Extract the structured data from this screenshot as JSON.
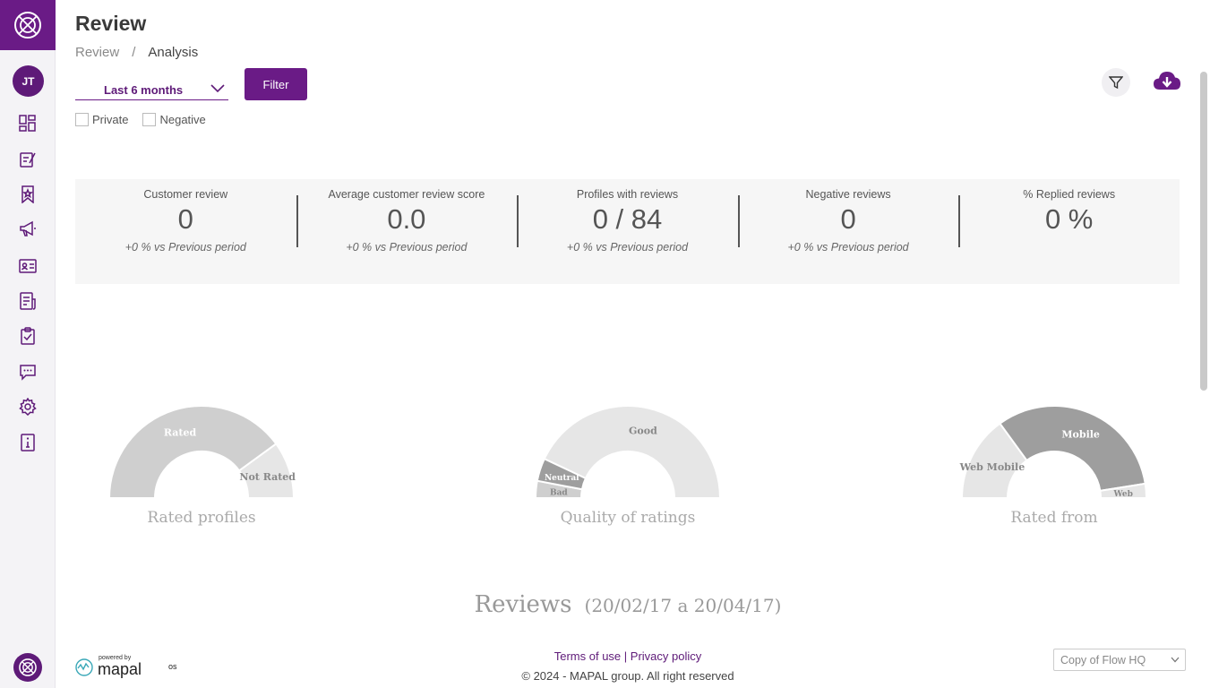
{
  "header": {
    "title": "Review"
  },
  "breadcrumb": {
    "root": "Review",
    "separator": "/",
    "current": "Analysis"
  },
  "filters": {
    "period": "Last 6 months",
    "filter_button": "Filter",
    "private_label": "Private",
    "negative_label": "Negative"
  },
  "sidebar": {
    "avatar_initials": "JT",
    "items": [
      {
        "icon": "dashboard-icon"
      },
      {
        "icon": "edit-icon"
      },
      {
        "icon": "bookmark-star-icon"
      },
      {
        "icon": "megaphone-icon"
      },
      {
        "icon": "id-card-icon"
      },
      {
        "icon": "document-icon"
      },
      {
        "icon": "checklist-icon"
      },
      {
        "icon": "chat-icon"
      },
      {
        "icon": "gear-icon"
      },
      {
        "icon": "info-icon"
      }
    ]
  },
  "kpis": [
    {
      "label": "Customer review",
      "value": "0",
      "delta": "+0 % vs Previous period"
    },
    {
      "label": "Average customer review score",
      "value": "0.0",
      "delta": "+0 % vs Previous period"
    },
    {
      "label": "Profiles with reviews",
      "value": "0 / 84",
      "delta": "+0 % vs Previous period"
    },
    {
      "label": "Negative reviews",
      "value": "0",
      "delta": "+0 % vs Previous period"
    },
    {
      "label": "% Replied reviews",
      "value": "0 %",
      "delta": ""
    }
  ],
  "gauges": [
    {
      "title": "Rated profiles",
      "segments": [
        {
          "label": "Rated",
          "share": 0.8
        },
        {
          "label": "Not Rated",
          "share": 0.2
        }
      ]
    },
    {
      "title": "Quality of ratings",
      "segments": [
        {
          "label": "Bad",
          "share": 0.06
        },
        {
          "label": "Neutral",
          "share": 0.08
        },
        {
          "label": "Good",
          "share": 0.86
        }
      ]
    },
    {
      "title": "Rated from",
      "segments": [
        {
          "label": "Web Mobile",
          "share": 0.3
        },
        {
          "label": "Mobile",
          "share": 0.65
        },
        {
          "label": "Web",
          "share": 0.05
        }
      ]
    }
  ],
  "reviews": {
    "title": "Reviews",
    "range": "(20/02/17 a 20/04/17)"
  },
  "footer": {
    "powered_by": "powered by",
    "brand": "mapal",
    "brand_suffix": "os",
    "terms": "Terms of use",
    "divider": "|",
    "privacy": "Privacy policy",
    "copyright": "© 2024 - MAPAL group. All right reserved",
    "site": "Copy of Flow HQ"
  },
  "colors": {
    "brand": "#6a1b86",
    "gauge_dark": "#9e9e9e",
    "gauge_mid": "#cfcfcf",
    "gauge_light": "#e6e6e6"
  }
}
